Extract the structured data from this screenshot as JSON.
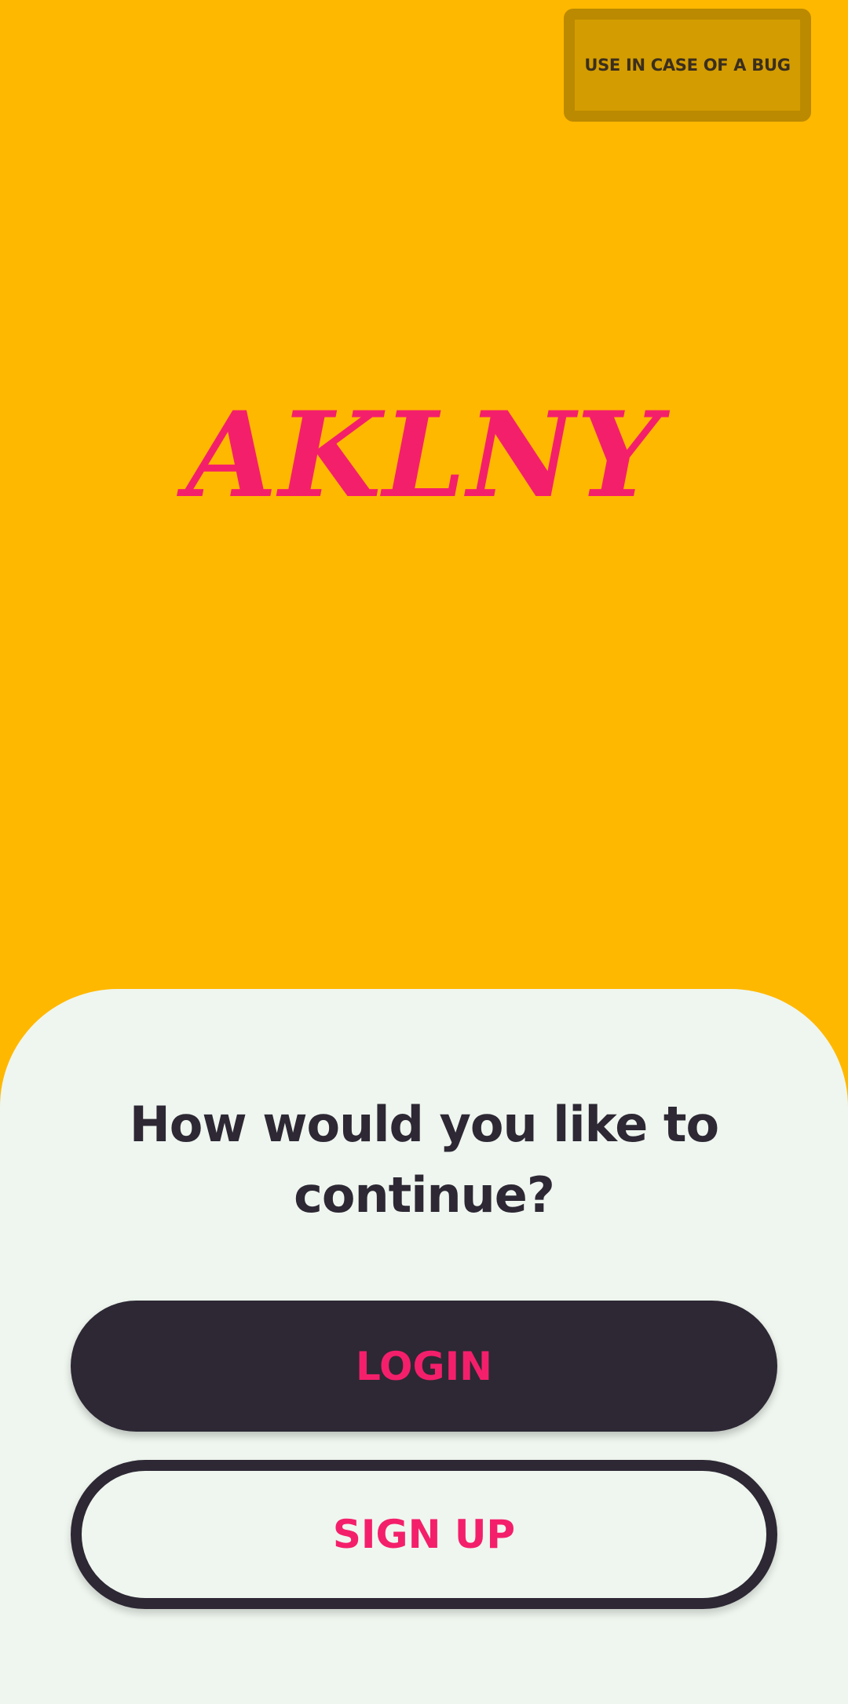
{
  "header": {
    "bug_button_label": "USE IN CASE OF A BUG"
  },
  "brand": {
    "logo_text": "AKLNY"
  },
  "auth": {
    "prompt": "How would you like to continue?",
    "login_label": "LOGIN",
    "signup_label": "SIGN UP"
  },
  "colors": {
    "background": "#FFB800",
    "brand_pink": "#F41F6B",
    "dark": "#2D2834",
    "sheet": "#EFF6EF"
  }
}
